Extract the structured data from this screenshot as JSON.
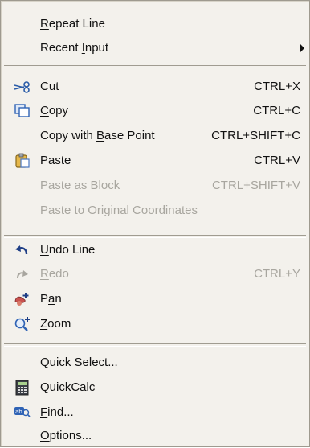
{
  "menu": {
    "groups": [
      {
        "items": [
          {
            "pre": "",
            "u": "R",
            "post": "epeat Line",
            "shortcut": "",
            "icon": "",
            "disabled": false,
            "submenu": false
          },
          {
            "pre": "Recent ",
            "u": "I",
            "post": "nput",
            "shortcut": "",
            "icon": "",
            "disabled": false,
            "submenu": true
          }
        ]
      },
      {
        "items": [
          {
            "pre": "Cu",
            "u": "t",
            "post": "",
            "shortcut": "CTRL+X",
            "icon": "scissors-icon",
            "disabled": false,
            "submenu": false
          },
          {
            "pre": "",
            "u": "C",
            "post": "opy",
            "shortcut": "CTRL+C",
            "icon": "copy-icon",
            "disabled": false,
            "submenu": false
          },
          {
            "pre": "Copy with ",
            "u": "B",
            "post": "ase Point",
            "shortcut": "CTRL+SHIFT+C",
            "icon": "",
            "disabled": false,
            "submenu": false
          },
          {
            "pre": "",
            "u": "P",
            "post": "aste",
            "shortcut": "CTRL+V",
            "icon": "paste-icon",
            "disabled": false,
            "submenu": false
          },
          {
            "pre": "Paste as Bloc",
            "u": "k",
            "post": "",
            "shortcut": "CTRL+SHIFT+V",
            "icon": "",
            "disabled": true,
            "submenu": false
          },
          {
            "pre": "Paste to Original Coor",
            "u": "d",
            "post": "inates",
            "shortcut": "",
            "icon": "",
            "disabled": true,
            "submenu": false
          }
        ]
      },
      {
        "items": [
          {
            "pre": "",
            "u": "U",
            "post": "ndo Line",
            "shortcut": "",
            "icon": "undo-icon",
            "disabled": false,
            "submenu": false
          },
          {
            "pre": "",
            "u": "R",
            "post": "edo",
            "shortcut": "CTRL+Y",
            "icon": "redo-icon",
            "disabled": true,
            "submenu": false
          },
          {
            "pre": "P",
            "u": "a",
            "post": "n",
            "shortcut": "",
            "icon": "pan-icon",
            "disabled": false,
            "submenu": false
          },
          {
            "pre": "",
            "u": "Z",
            "post": "oom",
            "shortcut": "",
            "icon": "zoom-icon",
            "disabled": false,
            "submenu": false
          }
        ]
      },
      {
        "items": [
          {
            "pre": "",
            "u": "Q",
            "post": "uick Select...",
            "shortcut": "",
            "icon": "",
            "disabled": false,
            "submenu": false
          },
          {
            "pre": "QuickCalc",
            "u": "",
            "post": "",
            "shortcut": "",
            "icon": "calculator-icon",
            "disabled": false,
            "submenu": false
          },
          {
            "pre": "",
            "u": "F",
            "post": "ind...",
            "shortcut": "",
            "icon": "find-icon",
            "disabled": false,
            "submenu": false
          },
          {
            "pre": "",
            "u": "O",
            "post": "ptions...",
            "shortcut": "",
            "icon": "",
            "disabled": false,
            "submenu": false
          }
        ]
      }
    ]
  }
}
